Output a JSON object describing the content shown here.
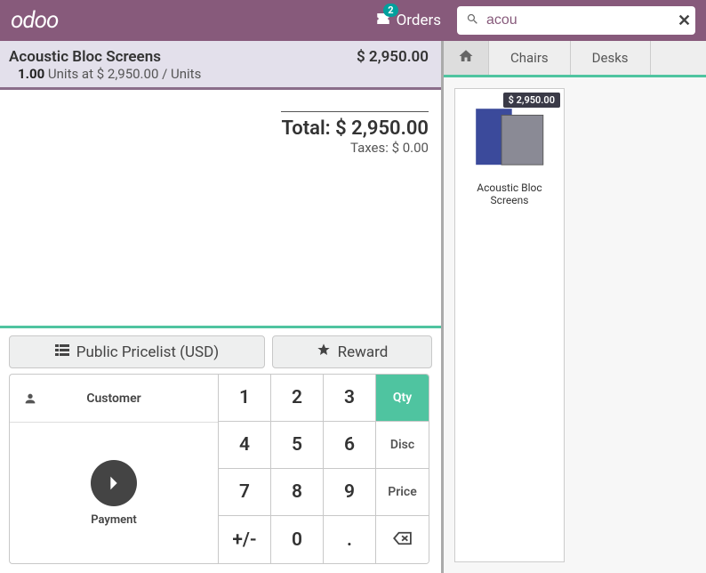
{
  "header": {
    "logo": "odoo",
    "orders_label": "Orders",
    "orders_badge": "2",
    "search_value": "acou"
  },
  "order": {
    "product_name": "Acoustic Bloc Screens",
    "qty": "1.00",
    "unit_text": "Units at",
    "unit_price": "$ 2,950.00",
    "unit_suffix": "/ Units",
    "line_price": "$ 2,950.00"
  },
  "summary": {
    "total_label": "Total:",
    "total_value": "$ 2,950.00",
    "taxes_label": "Taxes:",
    "taxes_value": "$ 0.00"
  },
  "buttons": {
    "pricelist": "Public Pricelist (USD)",
    "reward": "Reward",
    "customer": "Customer",
    "payment": "Payment"
  },
  "numpad": {
    "k1": "1",
    "k2": "2",
    "k3": "3",
    "qty": "Qty",
    "k4": "4",
    "k5": "5",
    "k6": "6",
    "disc": "Disc",
    "k7": "7",
    "k8": "8",
    "k9": "9",
    "price": "Price",
    "pm": "+/-",
    "k0": "0",
    "dot": "."
  },
  "categories": {
    "chairs": "Chairs",
    "desks": "Desks"
  },
  "products": [
    {
      "name": "Acoustic Bloc Screens",
      "price": "$ 2,950.00"
    }
  ]
}
